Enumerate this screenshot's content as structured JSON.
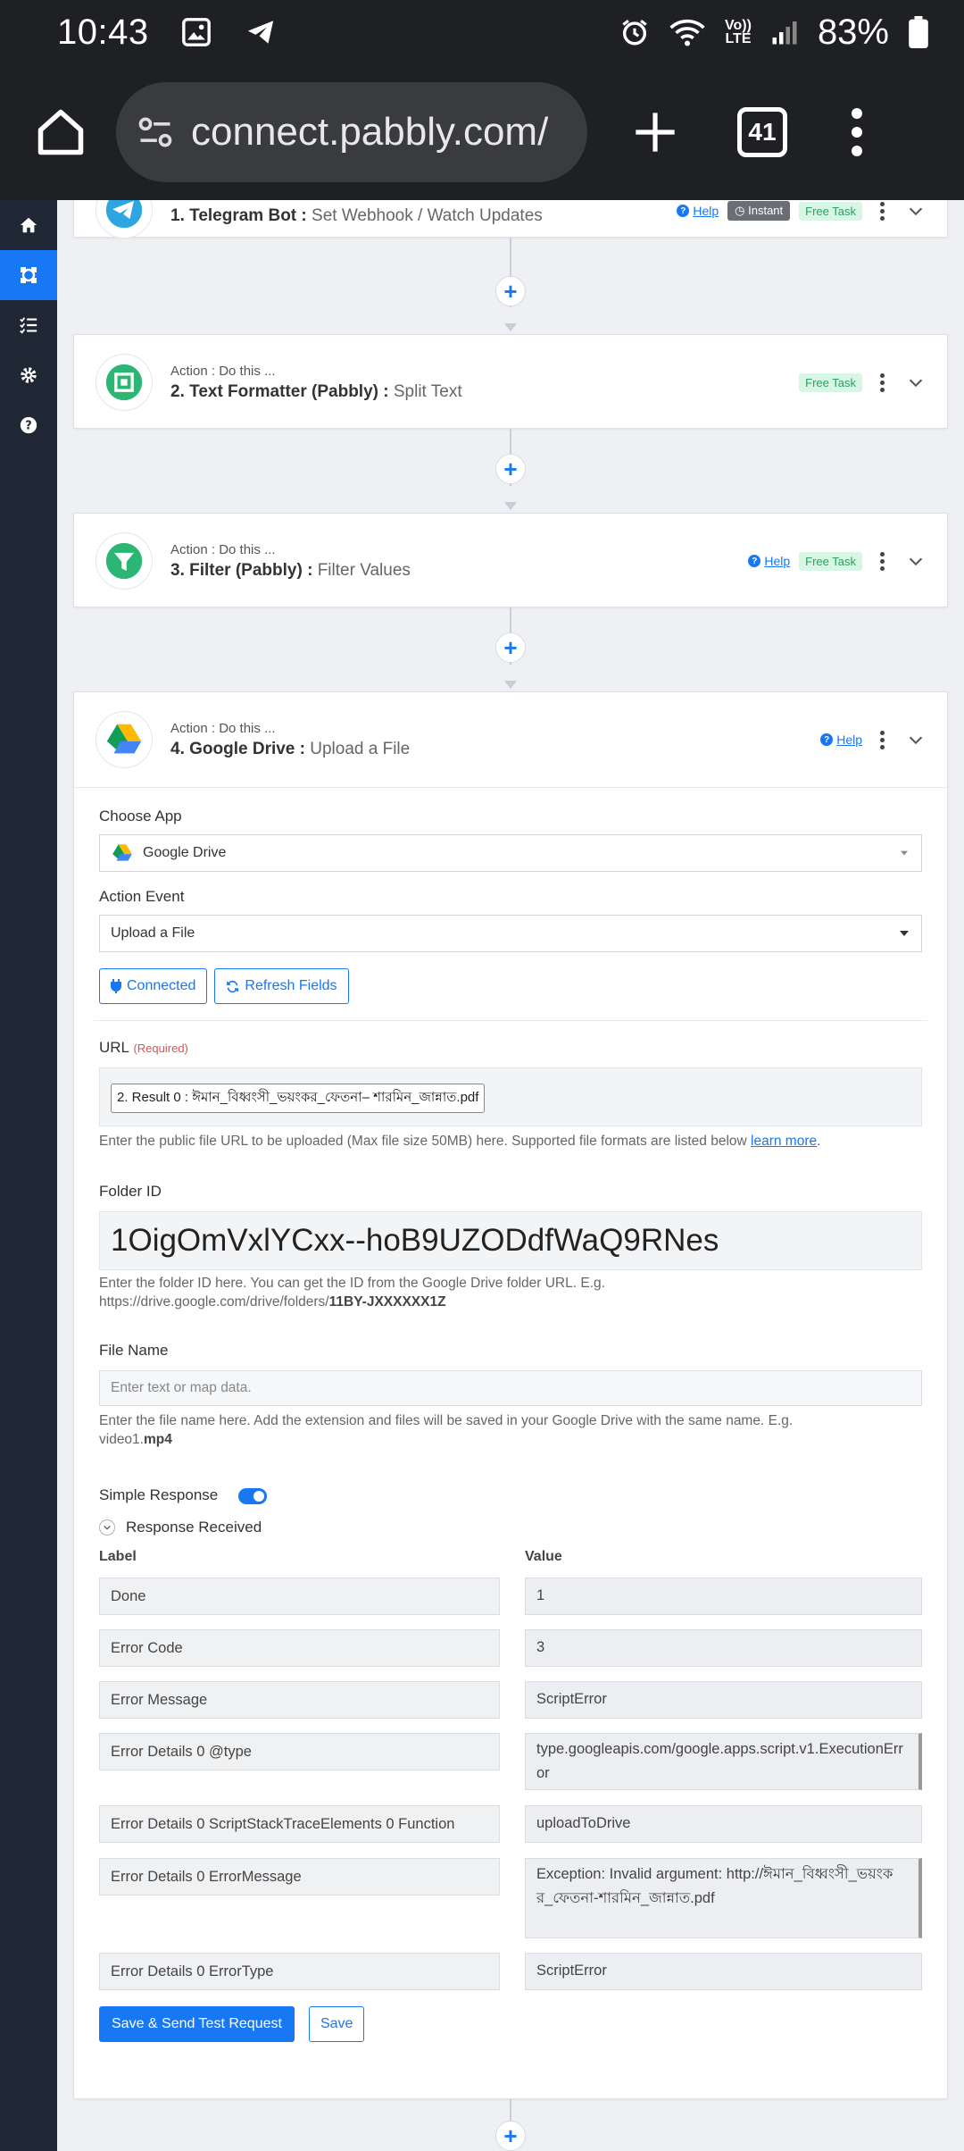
{
  "status_bar": {
    "time": "10:43",
    "battery": "83%",
    "lte_top": "Vo))",
    "lte_bottom": "LTE"
  },
  "browser": {
    "url": "connect.pabbly.com/",
    "tab_count": "41"
  },
  "steps": [
    {
      "number_title": "1. Telegram Bot :",
      "event": "Set Webhook / Watch Updates",
      "help": "Help",
      "instant": "Instant",
      "free": "Free Task"
    },
    {
      "sub": "Action : Do this ...",
      "number_title": "2. Text Formatter (Pabbly) :",
      "event": "Split Text",
      "free": "Free Task"
    },
    {
      "sub": "Action : Do this ...",
      "number_title": "3. Filter (Pabbly) :",
      "event": "Filter Values",
      "help": "Help",
      "free": "Free Task"
    },
    {
      "sub": "Action : Do this ...",
      "number_title": "4. Google Drive :",
      "event": "Upload a File",
      "help": "Help"
    }
  ],
  "form": {
    "choose_app_label": "Choose App",
    "choose_app_value": "Google Drive",
    "action_event_label": "Action Event",
    "action_event_value": "Upload a File",
    "connected_btn": "Connected",
    "refresh_btn": "Refresh Fields",
    "url_label": "URL",
    "url_required": "(Required)",
    "url_chip": "2. Result 0 : ঈমান_বিধ্বংসী_ভয়ংকর_ফেতনা– শারমিন_জান্নাত.pdf",
    "url_hint": "Enter the public file URL to be uploaded (Max file size 50MB) here. Supported file formats are listed below",
    "url_hint_link": "learn more",
    "folder_label": "Folder ID",
    "folder_value": "1OigOmVxlYCxx--hoB9UZODdfWaQ9RNes",
    "folder_hint_1": "Enter the folder ID here. You can get the ID from the Google Drive folder URL. E.g.",
    "folder_hint_2": "https://drive.google.com/drive/folders/",
    "folder_hint_bold": "11BY-JXXXXXX1Z",
    "filename_label": "File Name",
    "filename_placeholder": "Enter text or map data.",
    "filename_hint": "Enter the file name here. Add the extension and files will be saved in your Google Drive with the same name. E.g.",
    "filename_hint_2": "video1.",
    "filename_hint_bold": "mp4",
    "simple_response_label": "Simple Response",
    "response_received_label": "Response Received",
    "col_label": "Label",
    "col_value": "Value",
    "rows": [
      {
        "label": "Done",
        "value": "1"
      },
      {
        "label": "Error Code",
        "value": "3"
      },
      {
        "label": "Error Message",
        "value": "ScriptError"
      },
      {
        "label": "Error Details 0 @type",
        "value": "type.googleapis.com/google.apps.script.v1.ExecutionError"
      },
      {
        "label": "Error Details 0 ScriptStackTraceElements 0 Function",
        "value": "uploadToDrive"
      },
      {
        "label": "Error Details 0 ErrorMessage",
        "value": "Exception: Invalid argument: http://ঈমান_বিধ্বংসী_ভয়ংকর_ফেতনা-শারমিন_জান্নাত.pdf"
      },
      {
        "label": "Error Details 0 ErrorType",
        "value": "ScriptError"
      }
    ],
    "save_send_btn": "Save & Send Test Request",
    "save_btn": "Save"
  },
  "colors": {
    "accent": "#1877f2",
    "sidebar": "#1e2733",
    "free_badge": "#27a35f"
  }
}
